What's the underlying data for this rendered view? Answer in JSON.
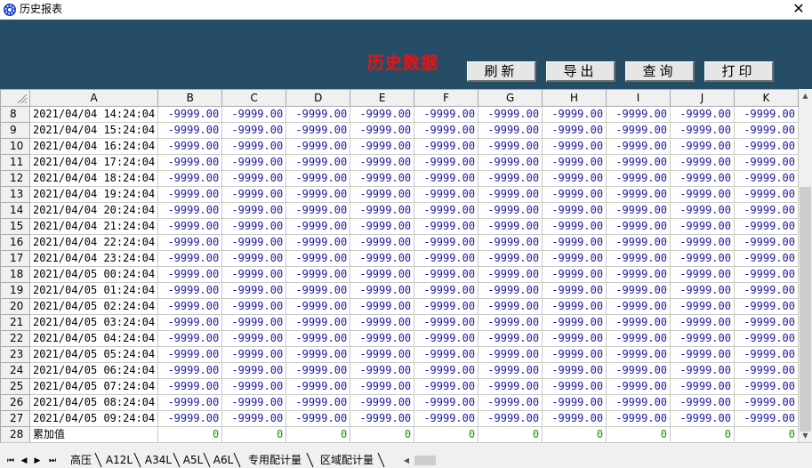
{
  "window": {
    "title": "历史报表"
  },
  "header": {
    "title": "历史数据"
  },
  "toolbar": {
    "refresh": "刷新",
    "export": "导出",
    "query": "查询",
    "print": "打印"
  },
  "grid": {
    "columns": [
      "A",
      "B",
      "C",
      "D",
      "E",
      "F",
      "G",
      "H",
      "I",
      "J",
      "K"
    ],
    "rows": [
      {
        "num": "8",
        "time": "2021/04/04 14:24:04"
      },
      {
        "num": "9",
        "time": "2021/04/04 15:24:04"
      },
      {
        "num": "10",
        "time": "2021/04/04 16:24:04"
      },
      {
        "num": "11",
        "time": "2021/04/04 17:24:04"
      },
      {
        "num": "12",
        "time": "2021/04/04 18:24:04"
      },
      {
        "num": "13",
        "time": "2021/04/04 19:24:04"
      },
      {
        "num": "14",
        "time": "2021/04/04 20:24:04"
      },
      {
        "num": "15",
        "time": "2021/04/04 21:24:04"
      },
      {
        "num": "16",
        "time": "2021/04/04 22:24:04"
      },
      {
        "num": "17",
        "time": "2021/04/04 23:24:04"
      },
      {
        "num": "18",
        "time": "2021/04/05 00:24:04"
      },
      {
        "num": "19",
        "time": "2021/04/05 01:24:04"
      },
      {
        "num": "20",
        "time": "2021/04/05 02:24:04"
      },
      {
        "num": "21",
        "time": "2021/04/05 03:24:04"
      },
      {
        "num": "22",
        "time": "2021/04/05 04:24:04"
      },
      {
        "num": "23",
        "time": "2021/04/05 05:24:04"
      },
      {
        "num": "24",
        "time": "2021/04/05 06:24:04"
      },
      {
        "num": "25",
        "time": "2021/04/05 07:24:04"
      },
      {
        "num": "26",
        "time": "2021/04/05 08:24:04"
      },
      {
        "num": "27",
        "time": "2021/04/05 09:24:04"
      }
    ],
    "cell_value": "-9999.00",
    "total": {
      "num": "28",
      "label": "累加值",
      "value": "0"
    }
  },
  "sheet_tabs": [
    "高压",
    "A12L",
    "A34L",
    "A5L",
    "A6L",
    "专用配计量",
    "区域配计量"
  ],
  "colors": {
    "header_bg": "#254e66",
    "title_red": "#ee1111",
    "value_blue": "#1a1aa6",
    "zero_green": "#1a8a1a"
  },
  "icons": {
    "app": "gear-icon",
    "close": "close-icon"
  }
}
